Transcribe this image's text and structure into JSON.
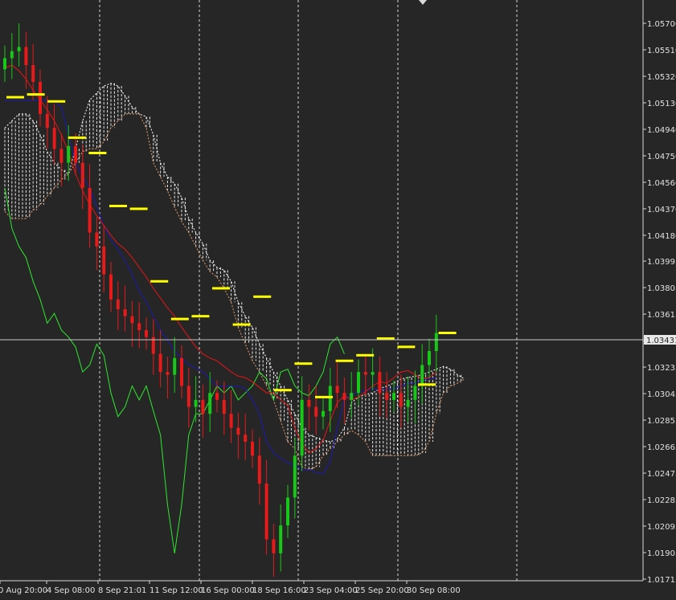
{
  "chart_data": {
    "type": "candlestick",
    "indicator": "ichimoku",
    "y_ticks": [
      "1.05700",
      "1.05510",
      "1.05320",
      "1.05130",
      "1.04940",
      "1.04750",
      "1.04560",
      "1.04370",
      "1.04180",
      "1.03995",
      "1.03805",
      "1.03615",
      "1.03425",
      "1.03235",
      "1.03045",
      "1.02855",
      "1.02665",
      "1.02475",
      "1.02285",
      "1.02095",
      "1.01905",
      "1.01715"
    ],
    "ylim": [
      1.01715,
      1.057
    ],
    "x_labels": [
      "0 Aug 20:00",
      "4 Sep 08:00",
      "8 Sep 21:01",
      "11 Sep 12:00",
      "16 Sep 00:00",
      "18 Sep 16:00",
      "23 Sep 04:00",
      "25 Sep 20:00",
      "30 Sep 08:00"
    ],
    "current_price": "1.03431",
    "colors": {
      "background": "#262626",
      "axis_text": "#e0e0e0",
      "bull_candle": "#18c818",
      "bear_candle": "#e81a1a",
      "tenkan": "#e81414",
      "kijun": "#1a1ab4",
      "chikou": "#2ee82e",
      "cloud_bear": "#e8a070",
      "cloud_bull": "#ffffff",
      "level_marks": "#ffff00",
      "price_line": "#c8c8c8"
    },
    "series": [
      {
        "name": "Tenkan",
        "values": [
          1.0538,
          1.054,
          1.0536,
          1.053,
          1.0522,
          1.0515,
          1.0508,
          1.05,
          1.049,
          1.0478,
          1.0462,
          1.045,
          1.044,
          1.0432,
          1.0425,
          1.0418,
          1.0412,
          1.0408,
          1.0402,
          1.0395,
          1.0388,
          1.038,
          1.0373,
          1.0366,
          1.036,
          1.0352,
          1.0345,
          1.0338,
          1.0333,
          1.033,
          1.0328,
          1.0324,
          1.032,
          1.0317,
          1.0316,
          1.0313,
          1.0309,
          1.0305,
          1.0305,
          1.03,
          1.0296,
          1.028,
          1.0268,
          1.0262,
          1.0265,
          1.0271,
          1.0285,
          1.0298,
          1.0303,
          1.03,
          1.0302,
          1.0306,
          1.031,
          1.0313,
          1.0312,
          1.0316,
          1.032,
          1.0321,
          1.0318,
          1.0315,
          1.0316,
          1.032
        ]
      },
      {
        "name": "Kijun",
        "values": [
          1.0515,
          1.0515,
          1.0515,
          1.0515,
          1.0515,
          1.0515,
          1.0515,
          1.0514,
          1.051,
          1.049,
          1.047,
          1.046,
          1.0452,
          1.0438,
          1.0425,
          1.0415,
          1.0408,
          1.04,
          1.039,
          1.0378,
          1.037,
          1.036,
          1.035,
          1.0343,
          1.0335,
          1.033,
          1.0325,
          1.0323,
          1.032,
          1.0315,
          1.031,
          1.031,
          1.031,
          1.031,
          1.0308,
          1.03,
          1.029,
          1.027,
          1.0262,
          1.0258,
          1.0255,
          1.0253,
          1.025,
          1.025,
          1.0248,
          1.0247,
          1.0256,
          1.028,
          1.03,
          1.0304,
          1.0305,
          1.0307,
          1.0308,
          1.0307,
          1.0308,
          1.0308,
          1.031,
          1.0312,
          1.0312,
          1.0314,
          1.0315,
          1.0316
        ]
      },
      {
        "name": "Chikou",
        "values": [
          1.0452,
          1.0423,
          1.041,
          1.0402,
          1.0385,
          1.0372,
          1.0355,
          1.0362,
          1.035,
          1.0345,
          1.0338,
          1.032,
          1.0325,
          1.034,
          1.0332,
          1.0305,
          1.0288,
          1.0295,
          1.031,
          1.03,
          1.031,
          1.0292,
          1.0275,
          1.0225,
          1.019,
          1.0225,
          1.0275,
          1.029,
          1.029,
          1.03,
          1.031,
          1.0305,
          1.031,
          1.03,
          1.0305,
          1.031,
          1.032,
          1.0315,
          1.03,
          1.032,
          1.0322,
          1.031,
          1.0305,
          1.0303,
          1.031,
          1.032,
          1.034,
          1.0345,
          1.0333
        ]
      },
      {
        "name": "SenkouA",
        "values": [
          1.0495,
          1.05,
          1.0505,
          1.0505,
          1.05,
          1.049,
          1.0478,
          1.047,
          1.0465,
          1.0462,
          1.048,
          1.05,
          1.0515,
          1.052,
          1.0525,
          1.0527,
          1.0525,
          1.0518,
          1.051,
          1.0505,
          1.0503,
          1.049,
          1.047,
          1.046,
          1.0455,
          1.0445,
          1.043,
          1.042,
          1.0412,
          1.04,
          1.0395,
          1.0393,
          1.0385,
          1.037,
          1.036,
          1.0352,
          1.034,
          1.033,
          1.032,
          1.031,
          1.03,
          1.029,
          1.028,
          1.0275,
          1.0273,
          1.0271,
          1.027,
          1.0272,
          1.028,
          1.0298,
          1.0302,
          1.0304,
          1.0305,
          1.0308,
          1.031,
          1.0312,
          1.0315,
          1.0316,
          1.0317,
          1.0318,
          1.032,
          1.0322,
          1.0324,
          1.0322,
          1.0318,
          1.0315
        ]
      },
      {
        "name": "SenkouB",
        "values": [
          1.0435,
          1.043,
          1.043,
          1.043,
          1.0436,
          1.044,
          1.0446,
          1.0452,
          1.0458,
          1.0462,
          1.047,
          1.0478,
          1.048,
          1.048,
          1.0485,
          1.0495,
          1.05,
          1.0505,
          1.0505,
          1.0505,
          1.0495,
          1.047,
          1.046,
          1.045,
          1.0438,
          1.0428,
          1.042,
          1.041,
          1.04,
          1.0392,
          1.0388,
          1.038,
          1.037,
          1.0352,
          1.034,
          1.0328,
          1.032,
          1.031,
          1.03,
          1.0285,
          1.027,
          1.0265,
          1.0252,
          1.025,
          1.0252,
          1.026,
          1.0265,
          1.027,
          1.0275,
          1.0278,
          1.0275,
          1.027,
          1.026,
          1.026,
          1.026,
          1.026,
          1.026,
          1.026,
          1.026,
          1.0262,
          1.027,
          1.029,
          1.0305,
          1.031,
          1.0312,
          1.0315
        ]
      },
      {
        "name": "Close",
        "values": [
          1.0545,
          1.055,
          1.0553,
          1.054,
          1.0528,
          1.0505,
          1.0495,
          1.048,
          1.047,
          1.0482,
          1.047,
          1.0452,
          1.042,
          1.041,
          1.039,
          1.0372,
          1.0365,
          1.036,
          1.0355,
          1.035,
          1.0345,
          1.0333,
          1.032,
          1.0318,
          1.033,
          1.031,
          1.0295,
          1.03,
          1.029,
          1.0305,
          1.03,
          1.029,
          1.028,
          1.0275,
          1.027,
          1.026,
          1.024,
          1.02,
          1.019,
          1.021,
          1.023,
          1.026,
          1.03,
          1.0295,
          1.0288,
          1.0292,
          1.031,
          1.0305,
          1.03,
          1.0305,
          1.032,
          1.0318,
          1.032,
          1.0305,
          1.03,
          1.0305,
          1.0295,
          1.03,
          1.031,
          1.0325,
          1.0335,
          1.0348
        ]
      }
    ],
    "level_marks": [
      1.0517,
      1.0519,
      1.0514,
      1.0488,
      1.0477,
      1.0439,
      1.0437,
      1.0385,
      1.0358,
      1.036,
      1.038,
      1.0354,
      1.0374,
      1.0307,
      1.0326,
      1.0302,
      1.0328,
      1.0332,
      1.0344,
      1.0338,
      1.0311,
      1.0348
    ]
  }
}
